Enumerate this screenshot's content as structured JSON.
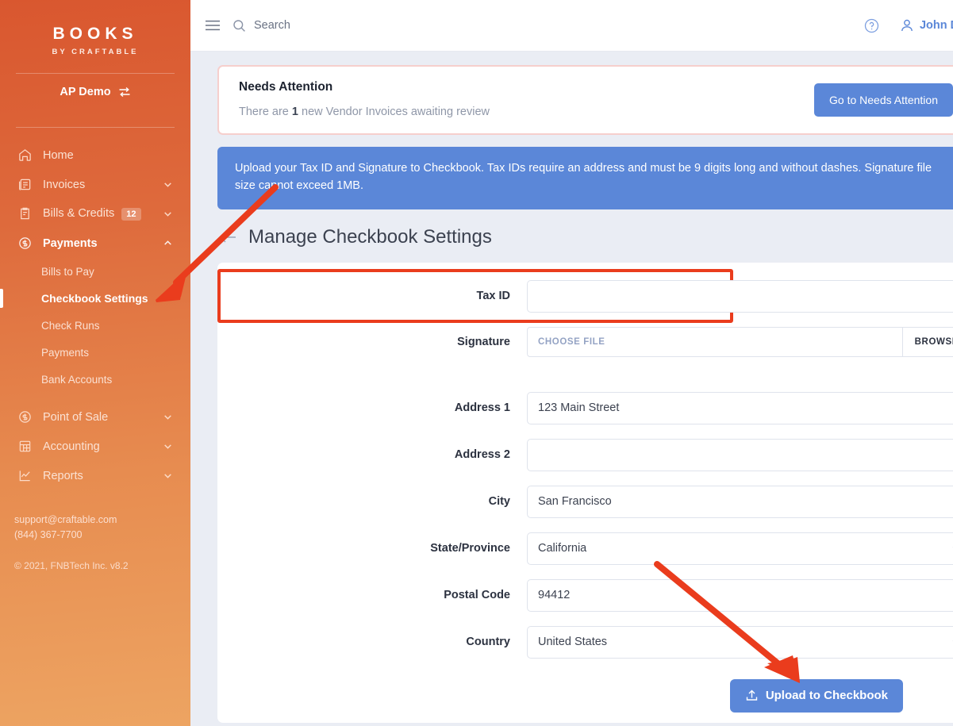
{
  "sidebar": {
    "brand_main": "BOOKS",
    "brand_sub": "BY CRAFTABLE",
    "tenant": "AP Demo",
    "nav": [
      {
        "label": "Home",
        "icon": "home-icon",
        "badge": null,
        "chevron": null
      },
      {
        "label": "Invoices",
        "icon": "invoice-icon",
        "badge": null,
        "chevron": "down"
      },
      {
        "label": "Bills & Credits",
        "icon": "bills-icon",
        "badge": "12",
        "chevron": "down"
      },
      {
        "label": "Payments",
        "icon": "dollar-icon",
        "badge": null,
        "chevron": "up"
      }
    ],
    "payments_sub": [
      {
        "label": "Bills to Pay",
        "active": false
      },
      {
        "label": "Checkbook Settings",
        "active": true
      },
      {
        "label": "Check Runs",
        "active": false
      },
      {
        "label": "Payments",
        "active": false
      },
      {
        "label": "Bank Accounts",
        "active": false
      }
    ],
    "nav_lower": [
      {
        "label": "Point of Sale",
        "icon": "dollar-icon",
        "chevron": "down"
      },
      {
        "label": "Accounting",
        "icon": "accounting-icon",
        "chevron": "down"
      },
      {
        "label": "Reports",
        "icon": "reports-icon",
        "chevron": "down"
      }
    ],
    "support_email": "support@craftable.com",
    "support_phone": "(844) 367-7700",
    "copyright": "© 2021, FNBTech Inc. v8.2"
  },
  "topbar": {
    "search_placeholder": "Search",
    "user_name": "John Doe"
  },
  "attention": {
    "title": "Needs Attention",
    "text_before": "There are ",
    "count": "1",
    "text_after": " new Vendor Invoices awaiting review",
    "button": "Go to Needs Attention"
  },
  "info_banner": {
    "text": "Upload your Tax ID and Signature to Checkbook. Tax IDs require an address and must be 9 digits long and without dashes. Signature file size cannot exceed 1MB."
  },
  "page": {
    "title": "Manage Checkbook Settings"
  },
  "form": {
    "tax_id": {
      "label": "Tax ID",
      "value": "",
      "placeholder": ""
    },
    "signature": {
      "label": "Signature",
      "chosen": "CHOOSE FILE",
      "browse": "BROWSE"
    },
    "address1": {
      "label": "Address 1",
      "value": "123 Main Street"
    },
    "address2": {
      "label": "Address 2",
      "value": ""
    },
    "city": {
      "label": "City",
      "value": "San Francisco"
    },
    "state": {
      "label": "State/Province",
      "value": "California"
    },
    "postal": {
      "label": "Postal Code",
      "value": "94412"
    },
    "country": {
      "label": "Country",
      "value": "United States"
    },
    "submit": "Upload to Checkbook"
  },
  "colors": {
    "sidebar_top": "#d9572f",
    "sidebar_bottom": "#eda462",
    "accent_blue": "#5b87d8",
    "annotation_red": "#ea3c1d",
    "page_bg": "#eaedf4"
  }
}
